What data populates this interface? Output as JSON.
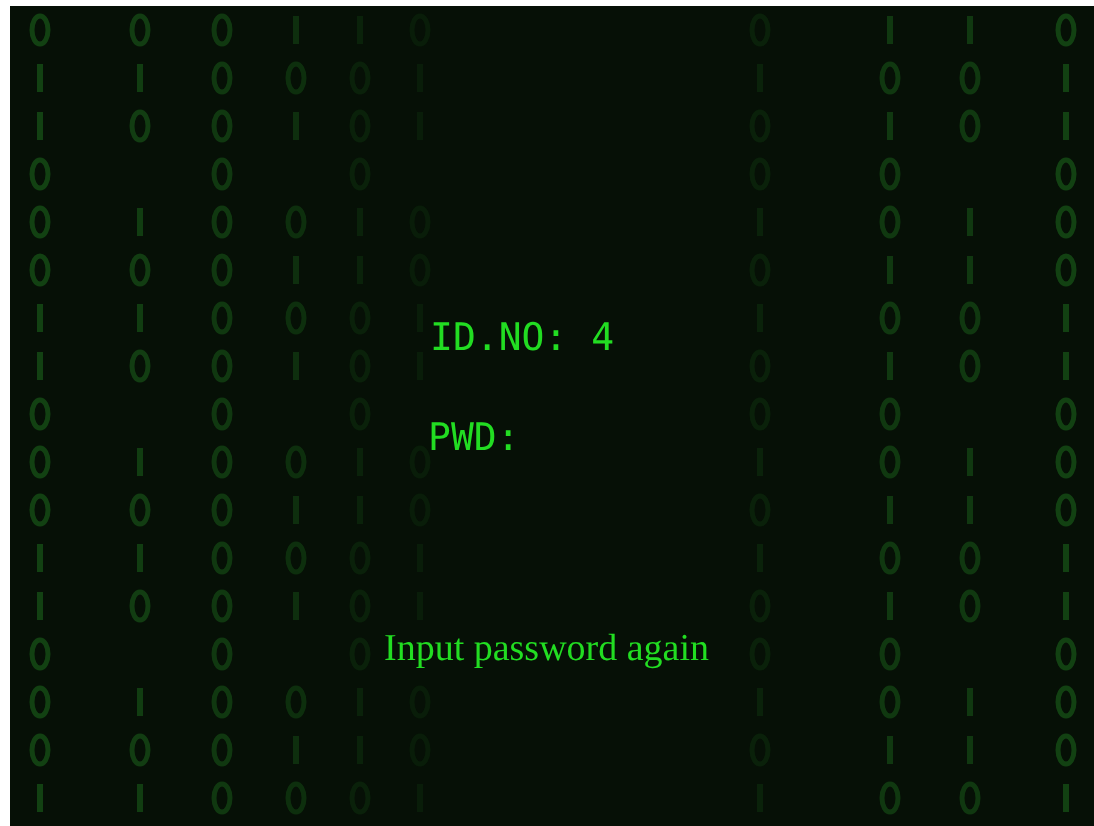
{
  "id_label": "ID.NO:",
  "id_value": "4",
  "password_label": "PWD:",
  "message": "Input password again"
}
